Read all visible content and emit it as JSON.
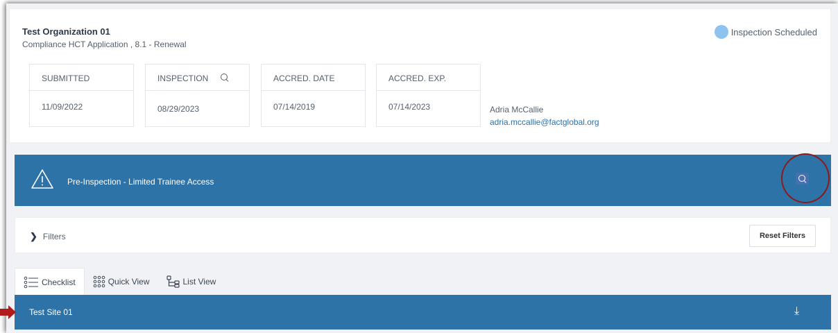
{
  "organization": {
    "name": "Test Organization 01",
    "application": "Compliance HCT Application , 8.1 - Renewal"
  },
  "status": {
    "label": "Inspection Scheduled",
    "color": "#8fc3ef"
  },
  "dates": [
    {
      "label": "SUBMITTED",
      "value": "11/09/2022"
    },
    {
      "label": "INSPECTION",
      "value": "08/29/2023"
    },
    {
      "label": "ACCRED. DATE",
      "value": "07/14/2019"
    },
    {
      "label": "ACCRED. EXP.",
      "value": "07/14/2023"
    }
  ],
  "contact": {
    "name": "Adria McCallie",
    "email": "adria.mccallie@factglobal.org"
  },
  "banner": {
    "text": "Pre-Inspection - Limited Trainee Access",
    "color": "#2d73a8"
  },
  "filters": {
    "label": "Filters",
    "reset_label": "Reset Filters"
  },
  "tabs": [
    {
      "label": "Checklist",
      "icon": "checklist-icon",
      "active": true
    },
    {
      "label": "Quick View",
      "icon": "grid-icon",
      "active": false
    },
    {
      "label": "List View",
      "icon": "tree-icon",
      "active": false
    }
  ],
  "site": {
    "name": "Test Site 01"
  },
  "annotations": {
    "circle_color": "#8b1a1a",
    "arrow_color": "#b01c1c"
  }
}
